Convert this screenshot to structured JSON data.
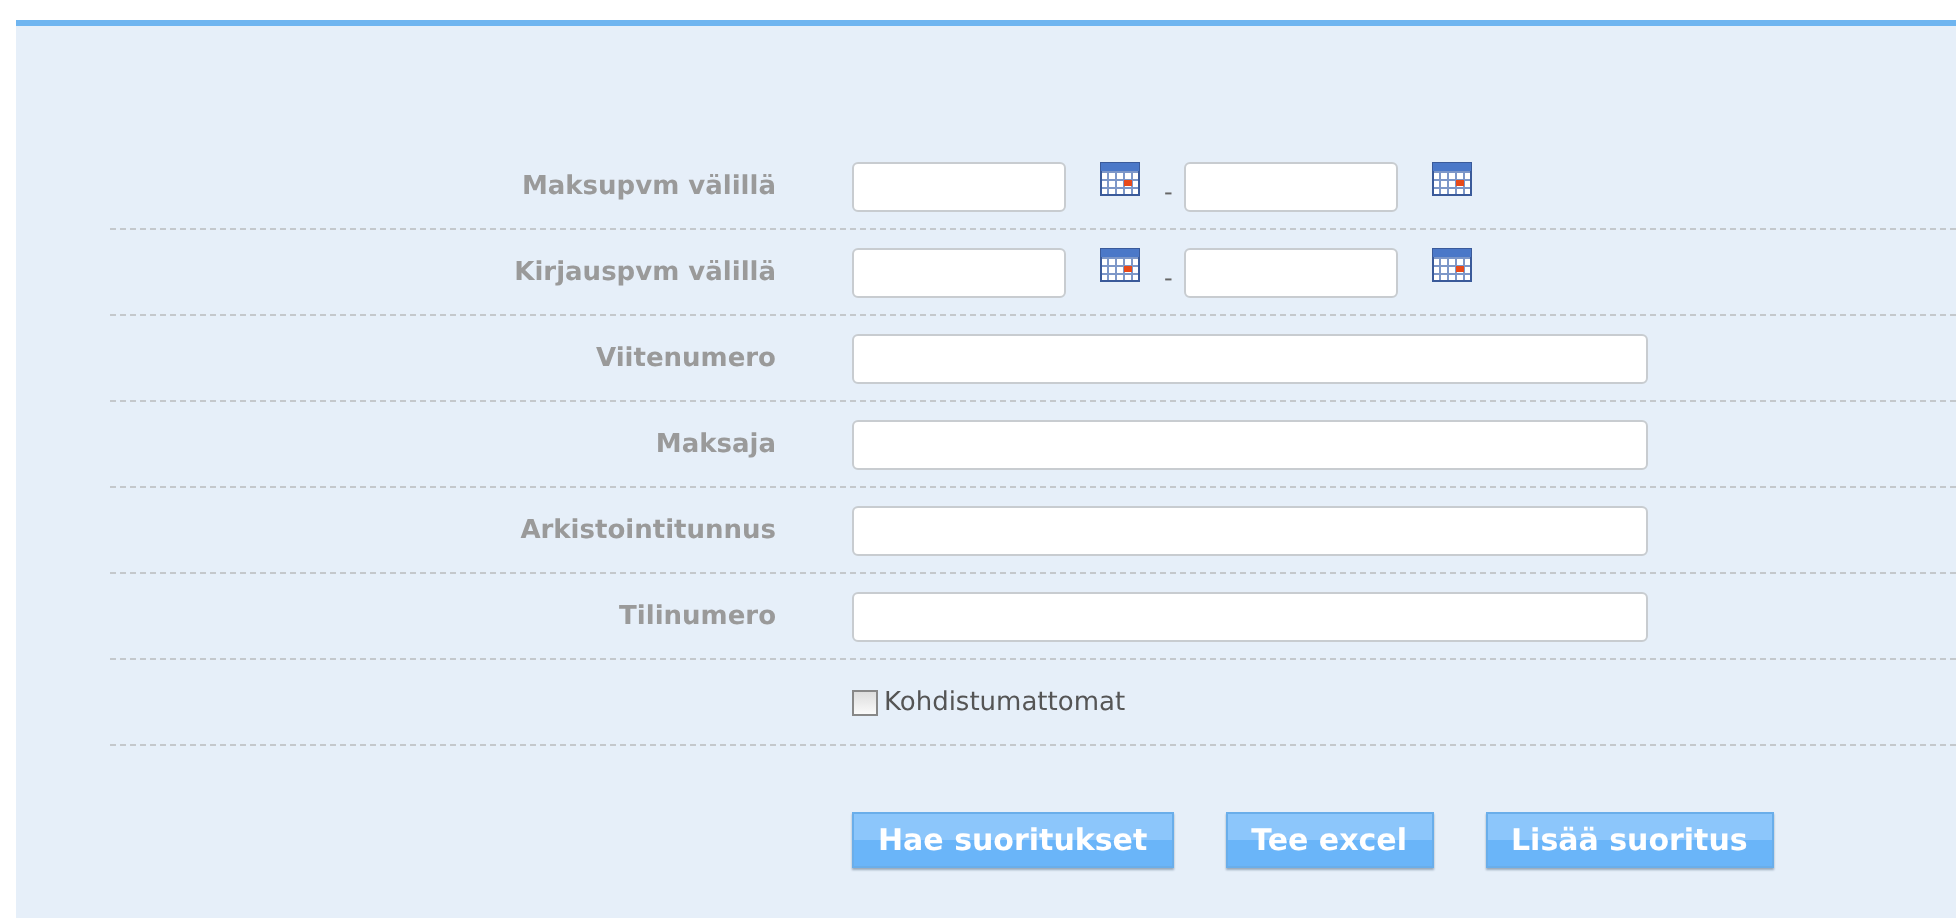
{
  "rows": [
    {
      "kind": "date_range",
      "label": "Maksupvm välillä",
      "separator": "-"
    },
    {
      "kind": "date_range",
      "label": "Kirjauspvm välillä",
      "separator": "-"
    },
    {
      "kind": "text",
      "label": "Viitenumero"
    },
    {
      "kind": "text",
      "label": "Maksaja"
    },
    {
      "kind": "text",
      "label": "Arkistointitunnus"
    },
    {
      "kind": "text",
      "label": "Tilinumero"
    },
    {
      "kind": "checkbox",
      "label": "Kohdistumattomat",
      "checked": false
    }
  ],
  "buttons": [
    "Hae suoritukset",
    "Tee excel",
    "Lisää suoritus"
  ]
}
